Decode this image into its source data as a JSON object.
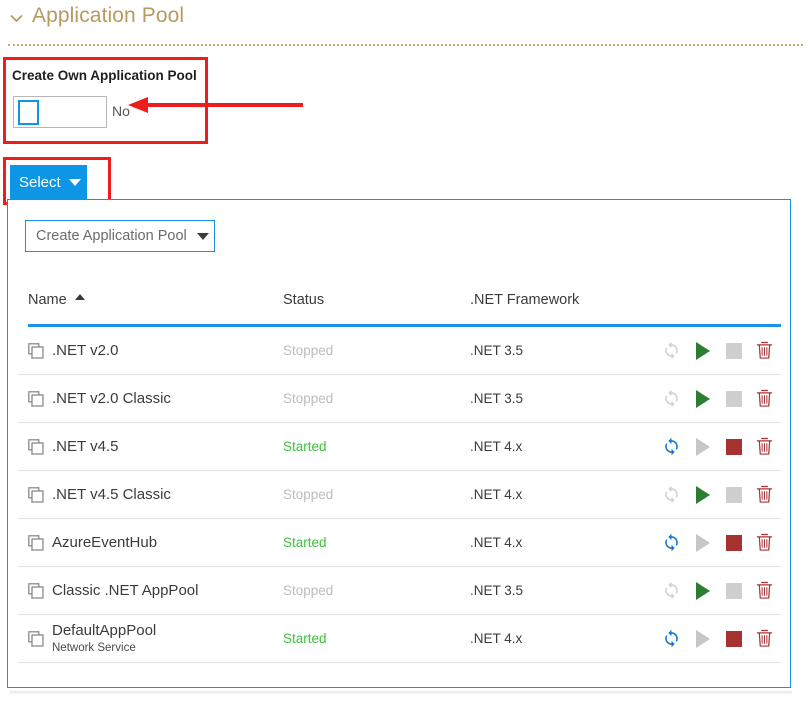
{
  "section": {
    "title": "Application Pool",
    "collapse_icon": "chevron-down-icon"
  },
  "create_own": {
    "label": "Create Own Application Pool",
    "checkbox_checked": false,
    "value_text": "No",
    "highlight_color": "#ee1c1c",
    "checkbox_border_color": "#0d96e6"
  },
  "select_button": {
    "label": "Select",
    "caret_icon": "caret-down-icon",
    "background": "#0d96e6",
    "highlight_color": "#ee1c1c"
  },
  "panel": {
    "border_color": "#1b8fe0",
    "create_button": {
      "label": "Create Application Pool",
      "caret_icon": "caret-down-icon"
    },
    "table": {
      "columns": [
        {
          "key": "name",
          "label": "Name",
          "sort": "ascending",
          "sort_icon": "sort-ascending-icon"
        },
        {
          "key": "status",
          "label": "Status",
          "sort": "none"
        },
        {
          "key": "framework",
          "label": ".NET Framework",
          "sort": "none"
        }
      ],
      "header_underline_color": "#1b93e8",
      "status_colors": {
        "Started": "#3cc13c",
        "Stopped": "#bdbdbd"
      },
      "action_labels": {
        "recycle": "Recycle",
        "start": "Start",
        "stop": "Stop",
        "delete": "Delete"
      },
      "rows": [
        {
          "name": ".NET v2.0",
          "sub": "",
          "status": "Stopped",
          "framework": ".NET 3.5",
          "recycle_enabled": false,
          "start_enabled": true,
          "stop_enabled": false
        },
        {
          "name": ".NET v2.0 Classic",
          "sub": "",
          "status": "Stopped",
          "framework": ".NET 3.5",
          "recycle_enabled": false,
          "start_enabled": true,
          "stop_enabled": false
        },
        {
          "name": ".NET v4.5",
          "sub": "",
          "status": "Started",
          "framework": ".NET 4.x",
          "recycle_enabled": true,
          "start_enabled": false,
          "stop_enabled": true
        },
        {
          "name": ".NET v4.5 Classic",
          "sub": "",
          "status": "Stopped",
          "framework": ".NET 4.x",
          "recycle_enabled": false,
          "start_enabled": true,
          "stop_enabled": false
        },
        {
          "name": "AzureEventHub",
          "sub": "",
          "status": "Started",
          "framework": ".NET 4.x",
          "recycle_enabled": true,
          "start_enabled": false,
          "stop_enabled": true
        },
        {
          "name": "Classic .NET AppPool",
          "sub": "",
          "status": "Stopped",
          "framework": ".NET 3.5",
          "recycle_enabled": false,
          "start_enabled": true,
          "stop_enabled": false
        },
        {
          "name": "DefaultAppPool",
          "sub": "Network Service",
          "status": "Started",
          "framework": ".NET 4.x",
          "recycle_enabled": true,
          "start_enabled": false,
          "stop_enabled": true
        }
      ]
    }
  },
  "annotation": {
    "arrow_icon": "left-arrow-annotation",
    "color": "#ee1c1c"
  }
}
